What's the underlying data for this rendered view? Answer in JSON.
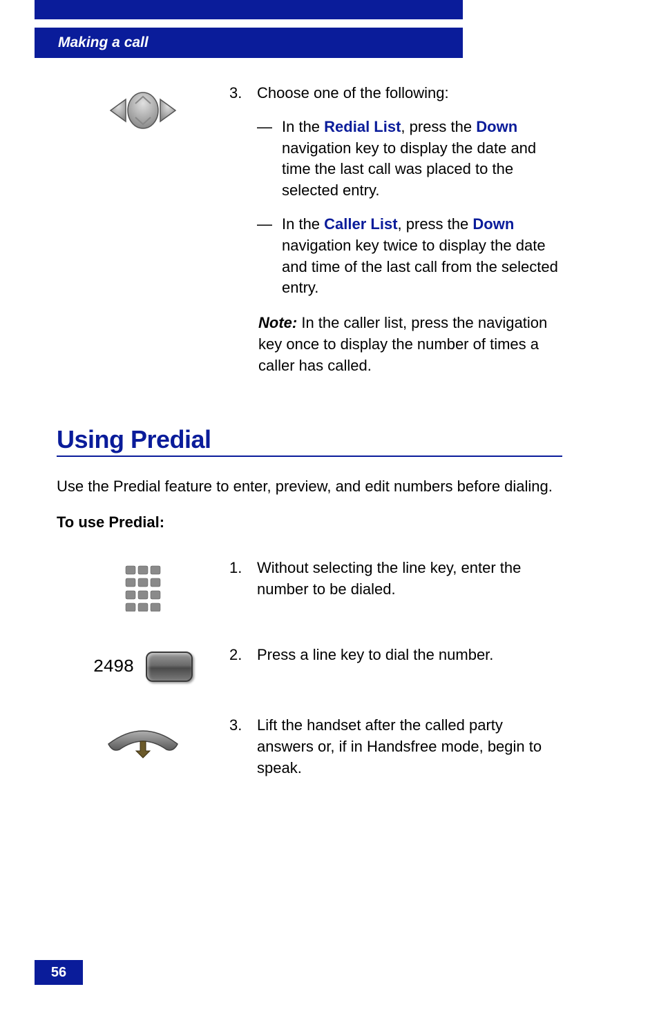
{
  "header": {
    "title": "Making a call"
  },
  "step3": {
    "number": "3.",
    "lead": "Choose one of the following:",
    "items": [
      {
        "prefix": "In the ",
        "term1": "Redial List",
        "mid": ", press the ",
        "term2": "Down",
        "rest": " navigation key to display the date and time the last call was placed to the selected entry."
      },
      {
        "prefix": "In the ",
        "term1": "Caller List",
        "mid": ", press the ",
        "term2": "Down",
        "rest": " navigation key twice to display the date and time of the last call from the selected entry."
      }
    ],
    "note_label": "Note:",
    "note_text": " In the caller list, press the navigation key once to display the number of times a caller has called."
  },
  "section": {
    "title": "Using Predial",
    "intro": "Use the Predial feature to enter, preview, and edit numbers before dialing.",
    "sub_heading": "To use Predial:"
  },
  "predial_steps": [
    {
      "num": "1.",
      "text": "Without selecting the line key, enter the number to be dialed."
    },
    {
      "num": "2.",
      "text": "Press a line key to dial the number."
    },
    {
      "num": "3.",
      "text": "Lift the handset after the called party answers or, if in Handsfree mode, begin to speak."
    }
  ],
  "linekey_number": "2498",
  "page_number": "56"
}
